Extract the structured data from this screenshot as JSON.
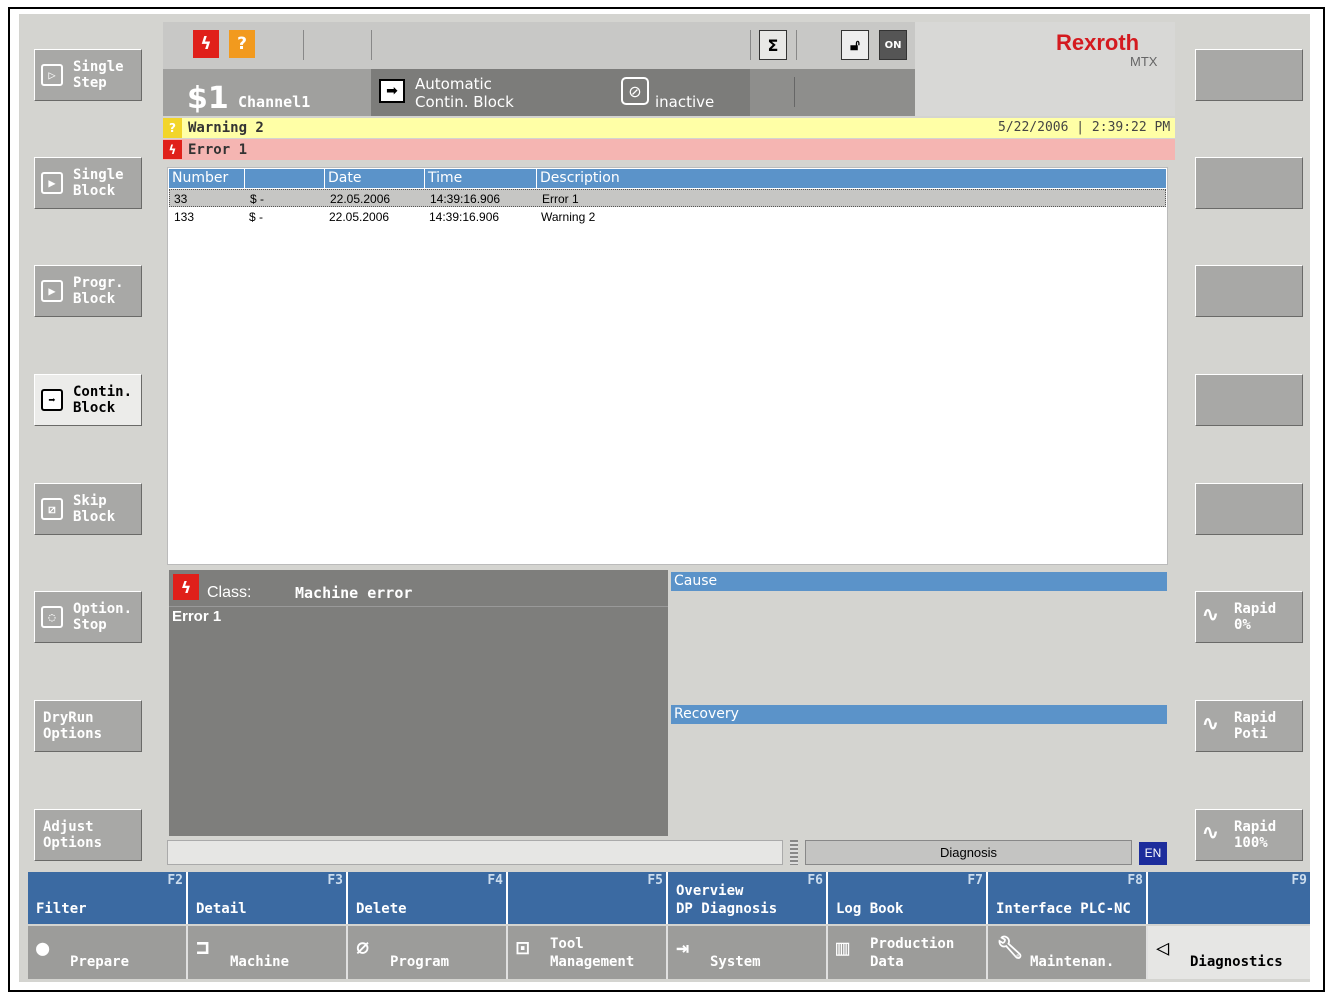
{
  "colors": {
    "accent": "#3b6aa2",
    "header_blue": "#5b93c9",
    "warning_bg": "#ffffa6",
    "error_bg": "#f5b5b2",
    "brand": "#d41a1f"
  },
  "left_buttons": [
    {
      "label1": "Single",
      "label2": "Step",
      "icon": "single-step-icon"
    },
    {
      "label1": "Single",
      "label2": "Block",
      "icon": "single-block-icon"
    },
    {
      "label1": "Progr.",
      "label2": "Block",
      "icon": "progr-block-icon"
    },
    {
      "label1": "Contin.",
      "label2": "Block",
      "icon": "contin-block-icon",
      "active": true
    },
    {
      "label1": "Skip",
      "label2": "Block",
      "icon": "skip-block-icon"
    },
    {
      "label1": "Option.",
      "label2": "Stop",
      "icon": "option-stop-icon"
    },
    {
      "label1": "DryRun",
      "label2": "Options"
    },
    {
      "label1": "Adjust",
      "label2": "Options"
    }
  ],
  "right_buttons": [
    {
      "label1": "Rapid",
      "label2": "0%"
    },
    {
      "label1": "Rapid",
      "label2": "Poti"
    },
    {
      "label1": "Rapid",
      "label2": "100%"
    }
  ],
  "header": {
    "brand": "Rexroth",
    "brand_sub": "MTX",
    "channel_prefix": "$1",
    "channel_name": "Channel1",
    "mode_line1": "Automatic",
    "mode_line2": "Contin. Block",
    "state": "inactive",
    "on_label": "ON"
  },
  "messages": {
    "warning": "Warning 2",
    "error": "Error 1",
    "timestamp": "5/22/2006 | 2:39:22 PM"
  },
  "table": {
    "columns": [
      "Number",
      "Date",
      "Time",
      "Description"
    ],
    "rows": [
      {
        "number": "33",
        "channel": "$ -",
        "date": "22.05.2006",
        "time": "14:39:16.906",
        "desc": "Error 1",
        "selected": true
      },
      {
        "number": "133",
        "channel": "$ -",
        "date": "22.05.2006",
        "time": "14:39:16.906",
        "desc": "Warning 2"
      }
    ]
  },
  "detail": {
    "class_label": "Class:",
    "class_value": "Machine error",
    "message": "Error 1",
    "cause_label": "Cause",
    "recovery_label": "Recovery"
  },
  "status": {
    "screen": "Diagnosis",
    "lang": "EN"
  },
  "fkeys": [
    {
      "num": "F2",
      "line1": "",
      "line2": "Filter"
    },
    {
      "num": "F3",
      "line1": "",
      "line2": "Detail"
    },
    {
      "num": "F4",
      "line1": "",
      "line2": "Delete"
    },
    {
      "num": "F5",
      "line1": "",
      "line2": ""
    },
    {
      "num": "F6",
      "line1": "Overview",
      "line2": "DP Diagnosis"
    },
    {
      "num": "F7",
      "line1": "",
      "line2": "Log Book"
    },
    {
      "num": "F8",
      "line1": "",
      "line2": "Interface PLC-NC"
    },
    {
      "num": "F9",
      "line1": "",
      "line2": ""
    }
  ],
  "modes": [
    {
      "line1": "",
      "line2": "Prepare",
      "icon": "prepare-icon"
    },
    {
      "line1": "",
      "line2": "Machine",
      "icon": "machine-icon"
    },
    {
      "line1": "",
      "line2": "Program",
      "icon": "program-icon"
    },
    {
      "line1": "Tool",
      "line2": "Management",
      "icon": "tool-management-icon"
    },
    {
      "line1": "",
      "line2": "System",
      "icon": "system-icon"
    },
    {
      "line1": "Production",
      "line2": "Data",
      "icon": "production-data-icon"
    },
    {
      "line1": "",
      "line2": "Maintenan.",
      "icon": "maintenance-icon"
    },
    {
      "line1": "",
      "line2": "Diagnostics",
      "icon": "diagnostics-icon",
      "active": true
    }
  ]
}
